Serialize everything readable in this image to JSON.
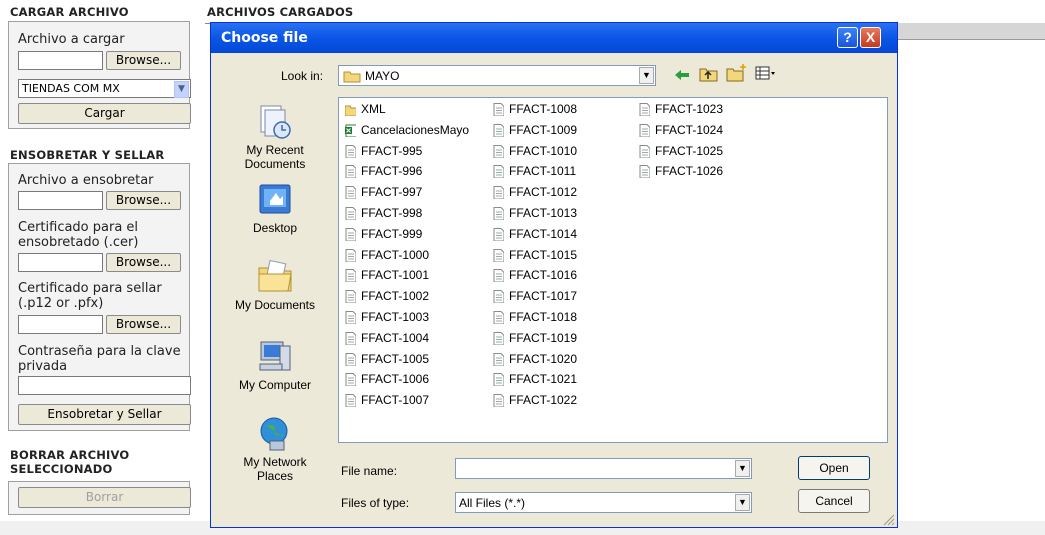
{
  "page": {
    "upload": {
      "heading": "CARGAR ARCHIVO",
      "file_label": "Archivo a cargar",
      "browse": "Browse...",
      "select_value": "TIENDAS COM MX",
      "submit": "Cargar"
    },
    "files_heading": "ARCHIVOS CARGADOS",
    "seal": {
      "heading": "ENSOBRETAR Y SELLAR",
      "file_label": "Archivo a ensobretar",
      "browse1": "Browse...",
      "cert_cer_label": "Certificado para el ensobretado (.cer)",
      "browse2": "Browse...",
      "cert_p12_label": "Certificado para sellar (.p12 or .pfx)",
      "browse3": "Browse...",
      "password_label": "Contraseña para la clave privada",
      "submit": "Ensobretar y Sellar"
    },
    "delete": {
      "heading": "BORRAR ARCHIVO SELECCIONADO",
      "submit": "Borrar"
    }
  },
  "dialog": {
    "title": "Choose file",
    "help": "?",
    "close": "X",
    "look_in_label": "Look in:",
    "look_in_value": "MAYO",
    "places": [
      {
        "label": "My Recent Documents",
        "icon": "recent-documents-icon"
      },
      {
        "label": "Desktop",
        "icon": "desktop-icon"
      },
      {
        "label": "My Documents",
        "icon": "my-documents-icon"
      },
      {
        "label": "My Computer",
        "icon": "my-computer-icon"
      },
      {
        "label": "My Network Places",
        "icon": "network-places-icon"
      }
    ],
    "columns": [
      [
        {
          "name": "XML",
          "type": "folder"
        },
        {
          "name": "CancelacionesMayo",
          "type": "excel"
        },
        {
          "name": "FFACT-995",
          "type": "text"
        },
        {
          "name": "FFACT-996",
          "type": "text"
        },
        {
          "name": "FFACT-997",
          "type": "text"
        },
        {
          "name": "FFACT-998",
          "type": "text"
        },
        {
          "name": "FFACT-999",
          "type": "text"
        },
        {
          "name": "FFACT-1000",
          "type": "text"
        },
        {
          "name": "FFACT-1001",
          "type": "text"
        },
        {
          "name": "FFACT-1002",
          "type": "text"
        },
        {
          "name": "FFACT-1003",
          "type": "text"
        },
        {
          "name": "FFACT-1004",
          "type": "text"
        },
        {
          "name": "FFACT-1005",
          "type": "text"
        },
        {
          "name": "FFACT-1006",
          "type": "text"
        },
        {
          "name": "FFACT-1007",
          "type": "text"
        }
      ],
      [
        {
          "name": "FFACT-1008",
          "type": "text"
        },
        {
          "name": "FFACT-1009",
          "type": "text"
        },
        {
          "name": "FFACT-1010",
          "type": "text"
        },
        {
          "name": "FFACT-1011",
          "type": "text"
        },
        {
          "name": "FFACT-1012",
          "type": "text"
        },
        {
          "name": "FFACT-1013",
          "type": "text"
        },
        {
          "name": "FFACT-1014",
          "type": "text"
        },
        {
          "name": "FFACT-1015",
          "type": "text"
        },
        {
          "name": "FFACT-1016",
          "type": "text"
        },
        {
          "name": "FFACT-1017",
          "type": "text"
        },
        {
          "name": "FFACT-1018",
          "type": "text"
        },
        {
          "name": "FFACT-1019",
          "type": "text"
        },
        {
          "name": "FFACT-1020",
          "type": "text"
        },
        {
          "name": "FFACT-1021",
          "type": "text"
        },
        {
          "name": "FFACT-1022",
          "type": "text"
        }
      ],
      [
        {
          "name": "FFACT-1023",
          "type": "text"
        },
        {
          "name": "FFACT-1024",
          "type": "text"
        },
        {
          "name": "FFACT-1025",
          "type": "text"
        },
        {
          "name": "FFACT-1026",
          "type": "text"
        }
      ]
    ],
    "file_name_label": "File name:",
    "file_name_value": "",
    "file_type_label": "Files of type:",
    "file_type_value": "All Files (*.*)",
    "open": "Open",
    "cancel": "Cancel"
  },
  "colors": {
    "title_bar": "#0a56e6",
    "close_button": "#e2563a",
    "dialog_face": "#ece9d8"
  }
}
